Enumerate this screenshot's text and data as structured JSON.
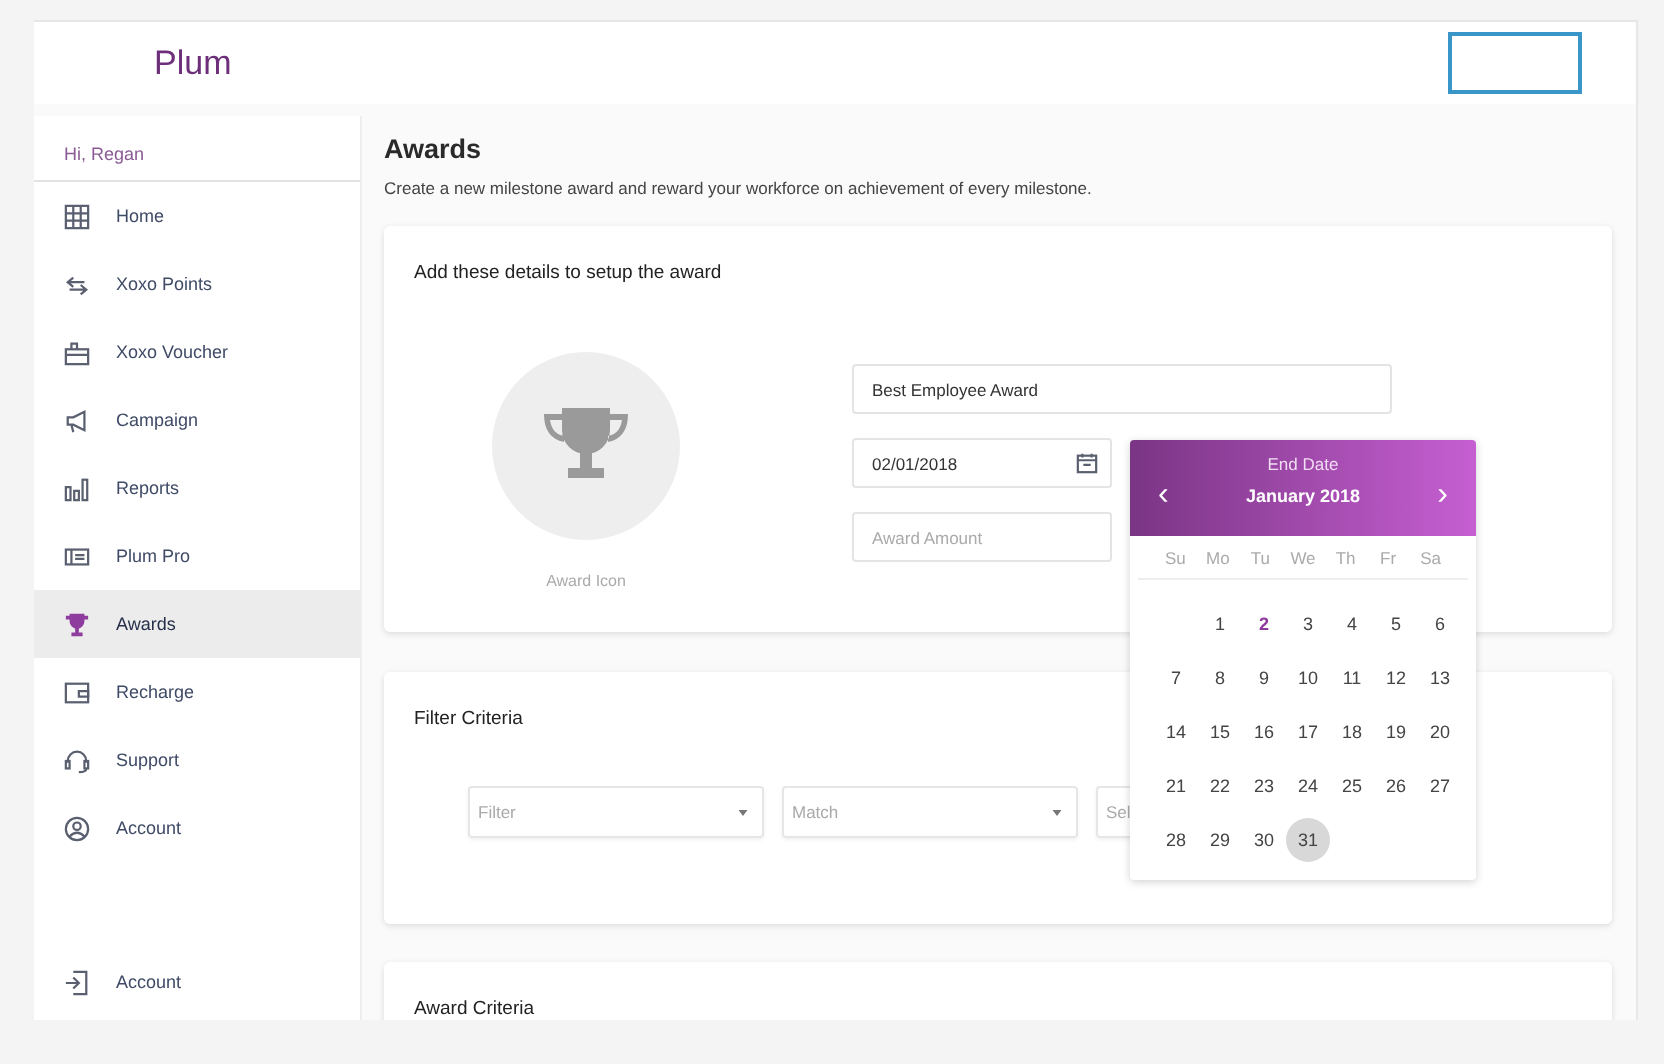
{
  "header": {
    "brand": "Plum"
  },
  "sidebar": {
    "greeting": "Hi, Regan",
    "items": [
      {
        "label": "Home",
        "selected": false
      },
      {
        "label": "Xoxo Points",
        "selected": false
      },
      {
        "label": "Xoxo Voucher",
        "selected": false
      },
      {
        "label": "Campaign",
        "selected": false
      },
      {
        "label": "Reports",
        "selected": false
      },
      {
        "label": "Plum Pro",
        "selected": false
      },
      {
        "label": "Awards",
        "selected": true
      },
      {
        "label": "Recharge",
        "selected": false
      },
      {
        "label": "Support",
        "selected": false
      },
      {
        "label": "Account",
        "selected": false
      }
    ],
    "footer_item": {
      "label": "Account"
    }
  },
  "page": {
    "title": "Awards",
    "subtitle": "Create a new milestone award and reward your workforce on achievement of every milestone."
  },
  "details_card": {
    "heading": "Add these details to setup the award",
    "award_icon_label": "Award Icon",
    "name_field": {
      "value": "Best Employee Award"
    },
    "date_field": {
      "value": "02/01/2018"
    },
    "amount_field": {
      "placeholder": "Award Amount"
    }
  },
  "date_picker": {
    "title": "End Date",
    "prev": "‹",
    "month": "January 2018",
    "next": "›",
    "weekdays": [
      "Su",
      "Mo",
      "Tu",
      "We",
      "Th",
      "Fr",
      "Sa"
    ],
    "weeks": [
      {
        "kind": "first",
        "days": [
          {
            "label": "1",
            "selected": false,
            "current": false
          },
          {
            "label": "2",
            "selected": false,
            "current": true
          },
          {
            "label": "3",
            "selected": false,
            "current": false
          },
          {
            "label": "4",
            "selected": false,
            "current": false
          },
          {
            "label": "5",
            "selected": false,
            "current": false
          },
          {
            "label": "6",
            "selected": false,
            "current": false
          }
        ]
      },
      {
        "kind": "full",
        "days": [
          {
            "label": "7",
            "selected": false,
            "current": false
          },
          {
            "label": "8",
            "selected": false,
            "current": false
          },
          {
            "label": "9",
            "selected": false,
            "current": false
          },
          {
            "label": "10",
            "selected": false,
            "current": false
          },
          {
            "label": "11",
            "selected": false,
            "current": false
          },
          {
            "label": "12",
            "selected": false,
            "current": false
          },
          {
            "label": "13",
            "selected": false,
            "current": false
          }
        ]
      },
      {
        "kind": "full",
        "days": [
          {
            "label": "14",
            "selected": false,
            "current": false
          },
          {
            "label": "15",
            "selected": false,
            "current": false
          },
          {
            "label": "16",
            "selected": false,
            "current": false
          },
          {
            "label": "17",
            "selected": false,
            "current": false
          },
          {
            "label": "18",
            "selected": false,
            "current": false
          },
          {
            "label": "19",
            "selected": false,
            "current": false
          },
          {
            "label": "20",
            "selected": false,
            "current": false
          }
        ]
      },
      {
        "kind": "full",
        "days": [
          {
            "label": "21",
            "selected": false,
            "current": false
          },
          {
            "label": "22",
            "selected": false,
            "current": false
          },
          {
            "label": "23",
            "selected": false,
            "current": false
          },
          {
            "label": "24",
            "selected": false,
            "current": false
          },
          {
            "label": "25",
            "selected": false,
            "current": false
          },
          {
            "label": "26",
            "selected": false,
            "current": false
          },
          {
            "label": "27",
            "selected": false,
            "current": false
          }
        ]
      },
      {
        "kind": "last",
        "days": [
          {
            "label": "28",
            "selected": false,
            "current": false
          },
          {
            "label": "29",
            "selected": false,
            "current": false
          },
          {
            "label": "30",
            "selected": false,
            "current": false
          },
          {
            "label": "31",
            "selected": true,
            "current": false
          }
        ]
      }
    ]
  },
  "filter_card": {
    "heading": "Filter Criteria",
    "selects": [
      {
        "placeholder": "Filter"
      },
      {
        "placeholder": "Match"
      },
      {
        "placeholder": "Sel"
      }
    ]
  },
  "award_card": {
    "heading": "Award Criteria"
  }
}
